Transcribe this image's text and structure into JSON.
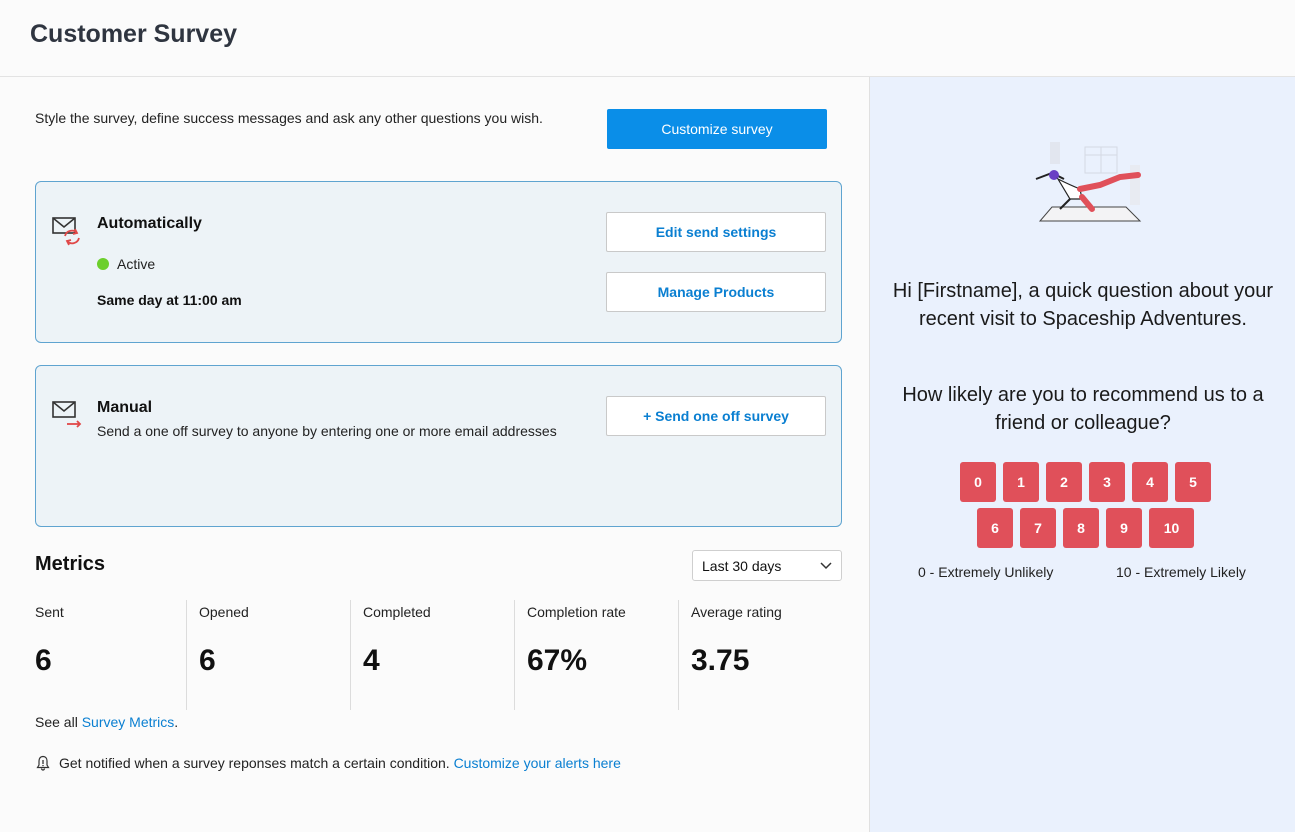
{
  "header": {
    "title": "Customer Survey"
  },
  "intro": {
    "text": "Style the survey, define success messages and ask any other questions you wish.",
    "customize_button": "Customize survey"
  },
  "automatic": {
    "title": "Automatically",
    "status": "Active",
    "schedule": "Same day at 11:00 am",
    "edit_button": "Edit send settings",
    "manage_button": "Manage Products"
  },
  "manual": {
    "title": "Manual",
    "description": "Send a one off survey to anyone by entering one or more email addresses",
    "send_button": "+ Send one off survey"
  },
  "metrics": {
    "title": "Metrics",
    "range": "Last 30 days",
    "items": [
      {
        "label": "Sent",
        "value": "6"
      },
      {
        "label": "Opened",
        "value": "6"
      },
      {
        "label": "Completed",
        "value": "4"
      },
      {
        "label": "Completion rate",
        "value": "67%"
      },
      {
        "label": "Average rating",
        "value": "3.75"
      }
    ],
    "see_all_prefix": "See all",
    "see_all_link": "Survey Metrics",
    "see_all_suffix": "."
  },
  "alert": {
    "text": "Get notified when a survey reponses match a certain condition.",
    "link": "Customize your alerts here"
  },
  "preview": {
    "greeting": "Hi [Firstname], a quick question about your recent visit to Spaceship Adventures.",
    "question": "How likely are you to recommend us to a friend or colleague?",
    "scores_row1": [
      "0",
      "1",
      "2",
      "3",
      "4",
      "5"
    ],
    "scores_row2": [
      "6",
      "7",
      "8",
      "9",
      "10"
    ],
    "low_label": "0 - Extremely Unlikely",
    "high_label": "10 - Extremely Likely"
  },
  "colors": {
    "primary": "#0a8ee8",
    "link": "#0a7fd1",
    "active": "#6ccf2c",
    "score": "#e0505a",
    "preview_bg": "#eaf1fd"
  }
}
